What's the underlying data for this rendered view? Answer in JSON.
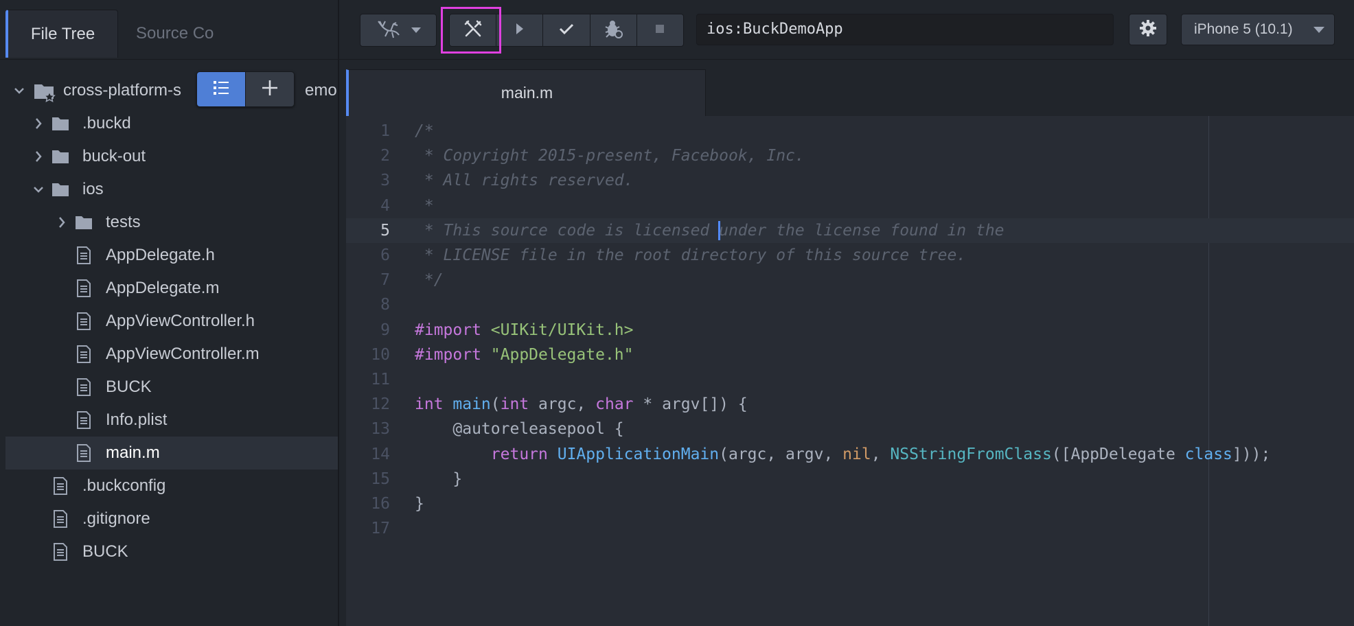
{
  "left_tabs": {
    "file_tree": "File Tree",
    "source_control": "Source Co"
  },
  "tree": {
    "root": "cross-platform-s",
    "root_suffix": "emo",
    "items": [
      {
        "label": ".buckd",
        "type": "folder",
        "expanded": false
      },
      {
        "label": "buck-out",
        "type": "folder",
        "expanded": false
      },
      {
        "label": "ios",
        "type": "folder",
        "expanded": true
      },
      {
        "label": "tests",
        "type": "folder",
        "expanded": false
      },
      {
        "label": "AppDelegate.h",
        "type": "file"
      },
      {
        "label": "AppDelegate.m",
        "type": "file"
      },
      {
        "label": "AppViewController.h",
        "type": "file"
      },
      {
        "label": "AppViewController.m",
        "type": "file"
      },
      {
        "label": "BUCK",
        "type": "file"
      },
      {
        "label": "Info.plist",
        "type": "file"
      },
      {
        "label": "main.m",
        "type": "file",
        "selected": true
      },
      {
        "label": ".buckconfig",
        "type": "file"
      },
      {
        "label": ".gitignore",
        "type": "file"
      },
      {
        "label": "BUCK",
        "type": "file"
      }
    ]
  },
  "toolbar": {
    "target": "ios:BuckDemoApp",
    "device": "iPhone 5 (10.1)",
    "buttons": [
      "buck-icon",
      "build-icon",
      "run-icon",
      "test-icon",
      "debug-icon",
      "stop-icon",
      "settings-icon"
    ]
  },
  "editor": {
    "tab": "main.m",
    "active_line": 5,
    "lines": [
      {
        "n": "1",
        "tokens": [
          [
            "cm",
            "/*"
          ]
        ]
      },
      {
        "n": "2",
        "tokens": [
          [
            "cm",
            " * Copyright 2015-present, Facebook, Inc."
          ]
        ]
      },
      {
        "n": "3",
        "tokens": [
          [
            "cm",
            " * All rights reserved."
          ]
        ]
      },
      {
        "n": "4",
        "tokens": [
          [
            "cm",
            " *"
          ]
        ]
      },
      {
        "n": "5",
        "tokens": [
          [
            "cm",
            " * This source code is licensed "
          ],
          [
            "cursor",
            ""
          ],
          [
            "cm",
            "under the license found in the"
          ]
        ]
      },
      {
        "n": "6",
        "tokens": [
          [
            "cm",
            " * LICENSE file in the root directory of this source tree."
          ]
        ]
      },
      {
        "n": "7",
        "tokens": [
          [
            "cm",
            " */"
          ]
        ]
      },
      {
        "n": "8",
        "tokens": []
      },
      {
        "n": "9",
        "tokens": [
          [
            "kw",
            "#import "
          ],
          [
            "str",
            "<UIKit/UIKit.h>"
          ]
        ]
      },
      {
        "n": "10",
        "tokens": [
          [
            "kw",
            "#import "
          ],
          [
            "str",
            "\"AppDelegate.h\""
          ]
        ]
      },
      {
        "n": "11",
        "tokens": []
      },
      {
        "n": "12",
        "tokens": [
          [
            "kw",
            "int "
          ],
          [
            "fn",
            "main"
          ],
          [
            "pl",
            "("
          ],
          [
            "kw",
            "int "
          ],
          [
            "pl",
            "argc, "
          ],
          [
            "kw",
            "char "
          ],
          [
            "pl",
            "* argv[]) {"
          ]
        ]
      },
      {
        "n": "13",
        "tokens": [
          [
            "pl",
            "    @autoreleasepool {"
          ]
        ]
      },
      {
        "n": "14",
        "tokens": [
          [
            "pl",
            "        "
          ],
          [
            "kw",
            "return "
          ],
          [
            "fn",
            "UIApplicationMain"
          ],
          [
            "pl",
            "(argc, argv, "
          ],
          [
            "num",
            "nil"
          ],
          [
            "pl",
            ", "
          ],
          [
            "typ",
            "NSStringFromClass"
          ],
          [
            "pl",
            "([AppDelegate "
          ],
          [
            "fn",
            "class"
          ],
          [
            "pl",
            "]));"
          ]
        ]
      },
      {
        "n": "15",
        "tokens": [
          [
            "pl",
            "    }"
          ]
        ]
      },
      {
        "n": "16",
        "tokens": [
          [
            "pl",
            "}"
          ]
        ]
      },
      {
        "n": "17",
        "tokens": []
      }
    ]
  }
}
